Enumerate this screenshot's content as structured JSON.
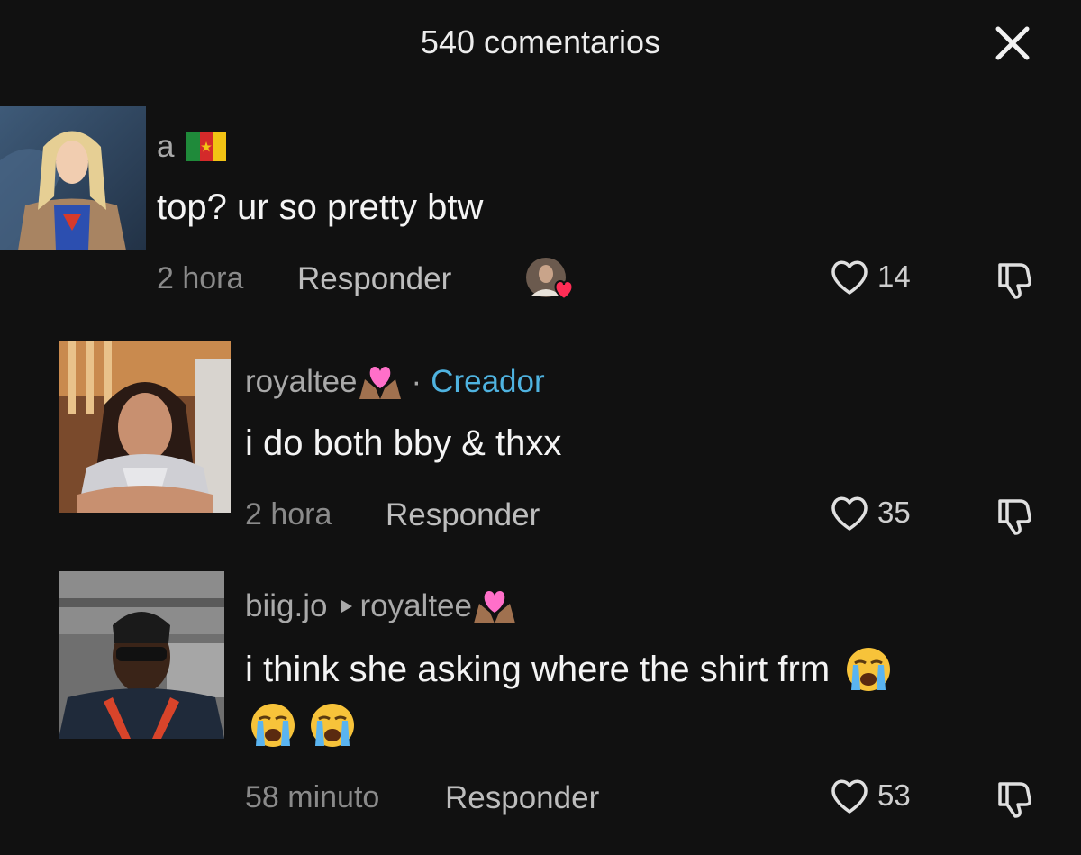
{
  "header": {
    "title": "540 comentarios",
    "close_icon": "close-icon"
  },
  "comments": [
    {
      "username": "a",
      "flag_icon": "cameroon-flag-icon",
      "text": "top? ur so pretty btw",
      "time": "2 hora",
      "reply_label": "Responder",
      "likes": "14",
      "creator_liked": true
    },
    {
      "username": "royaltee",
      "badge_icon": "hearts-hands-emoji-icon",
      "separator": "·",
      "creator_label": "Creador",
      "text": "i do both bby & thxx",
      "time": "2 hora",
      "reply_label": "Responder",
      "likes": "35"
    },
    {
      "username": "biig.jo",
      "reply_to": "royaltee",
      "text": "i think she asking where the shirt frm",
      "time": "58 minuto",
      "reply_label": "Responder",
      "likes": "53",
      "emoji_icon": "loudly-crying-face-icon"
    }
  ],
  "colors": {
    "background": "#111111",
    "creator_blue": "#4fb3e0",
    "like_heart_red": "#ff2d55"
  }
}
